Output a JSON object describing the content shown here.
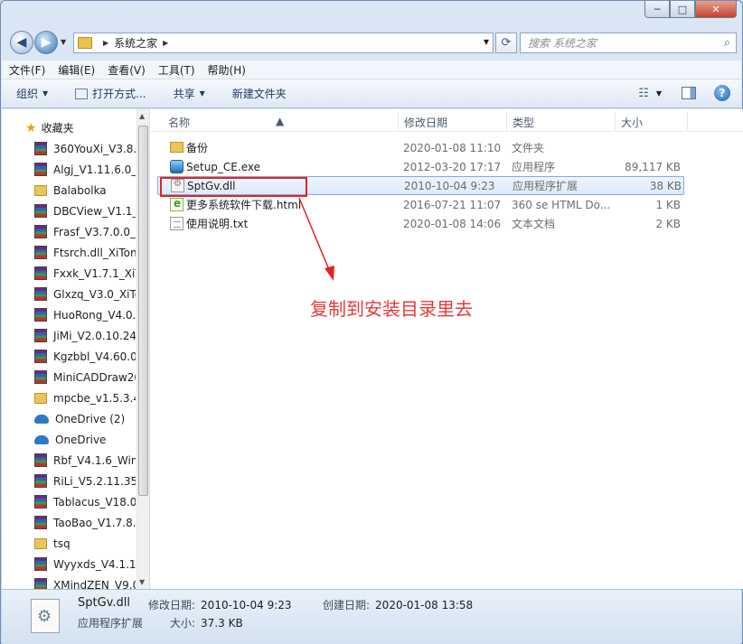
{
  "window": {
    "caption_buttons": [
      "─",
      "□",
      "✕"
    ]
  },
  "address": {
    "path": "系统之家",
    "search_placeholder": "搜索 系统之家"
  },
  "menu": [
    "文件(F)",
    "编辑(E)",
    "查看(V)",
    "工具(T)",
    "帮助(H)"
  ],
  "toolbar": {
    "organize": "组织",
    "open_with": "打开方式...",
    "share": "共享",
    "new_folder": "新建文件夹"
  },
  "nav": {
    "favorites": "收藏夹",
    "items": [
      {
        "label": "360YouXi_V3.8.7",
        "icon": "rar-icon"
      },
      {
        "label": "Algj_V1.11.6.0_X",
        "icon": "rar-icon"
      },
      {
        "label": "Balabolka",
        "icon": "folder-icon"
      },
      {
        "label": "DBCView_V1.1_",
        "icon": "rar-icon"
      },
      {
        "label": "Frasf_V3.7.0.0_X",
        "icon": "rar-icon"
      },
      {
        "label": "Ftsrch.dll_XiTon",
        "icon": "rar-icon"
      },
      {
        "label": "Fxxk_V1.7.1_XiT",
        "icon": "rar-icon"
      },
      {
        "label": "Glxzq_V3.0_XiTo",
        "icon": "rar-icon"
      },
      {
        "label": "HuoRong_V4.0.",
        "icon": "rar-icon"
      },
      {
        "label": "JiMi_V2.0.10.24_",
        "icon": "rar-icon"
      },
      {
        "label": "Kgzbbl_V4.60.0",
        "icon": "rar-icon"
      },
      {
        "label": "MiniCADDraw20",
        "icon": "rar-icon"
      },
      {
        "label": "mpcbe_v1.5.3.4",
        "icon": "folder-icon"
      },
      {
        "label": "OneDrive (2)",
        "icon": "cloud-icon"
      },
      {
        "label": "OneDrive",
        "icon": "cloud-icon"
      },
      {
        "label": "Rbf_V4.1.6_Win",
        "icon": "rar-icon"
      },
      {
        "label": "RiLi_V5.2.11.354",
        "icon": "rar-icon"
      },
      {
        "label": "Tablacus_V18.0",
        "icon": "rar-icon"
      },
      {
        "label": "TaoBao_V1.7.8.",
        "icon": "rar-icon"
      },
      {
        "label": "tsq",
        "icon": "folder-icon"
      },
      {
        "label": "Wyyxds_V4.1.1.",
        "icon": "rar-icon"
      },
      {
        "label": "XMindZEN_V9.0",
        "icon": "rar-icon"
      }
    ]
  },
  "columns": {
    "name": "名称",
    "date": "修改日期",
    "type": "类型",
    "size": "大小"
  },
  "files": [
    {
      "name": "备份",
      "date": "2020-01-08 11:10",
      "type": "文件夹",
      "size": "",
      "icon": "folder-icon"
    },
    {
      "name": "Setup_CE.exe",
      "date": "2012-03-20 17:17",
      "type": "应用程序",
      "size": "89,117 KB",
      "icon": "exe-icon"
    },
    {
      "name": "SptGv.dll",
      "date": "2010-10-04 9:23",
      "type": "应用程序扩展",
      "size": "38 KB",
      "icon": "dll-icon",
      "selected": true
    },
    {
      "name": "更多系统软件下载.html",
      "date": "2016-07-21 11:07",
      "type": "360 se HTML Do...",
      "size": "1 KB",
      "icon": "html-icon"
    },
    {
      "name": "使用说明.txt",
      "date": "2020-01-08 14:06",
      "type": "文本文档",
      "size": "2 KB",
      "icon": "txt-icon"
    }
  ],
  "annotation": {
    "text": "复制到安装目录里去",
    "color": "#e33a3a"
  },
  "details": {
    "name": "SptGv.dll",
    "type": "应用程序扩展",
    "modified_label": "修改日期:",
    "modified": "2010-10-04 9:23",
    "created_label": "创建日期:",
    "created": "2020-01-08 13:58",
    "size_label": "大小:",
    "size": "37.3 KB"
  }
}
